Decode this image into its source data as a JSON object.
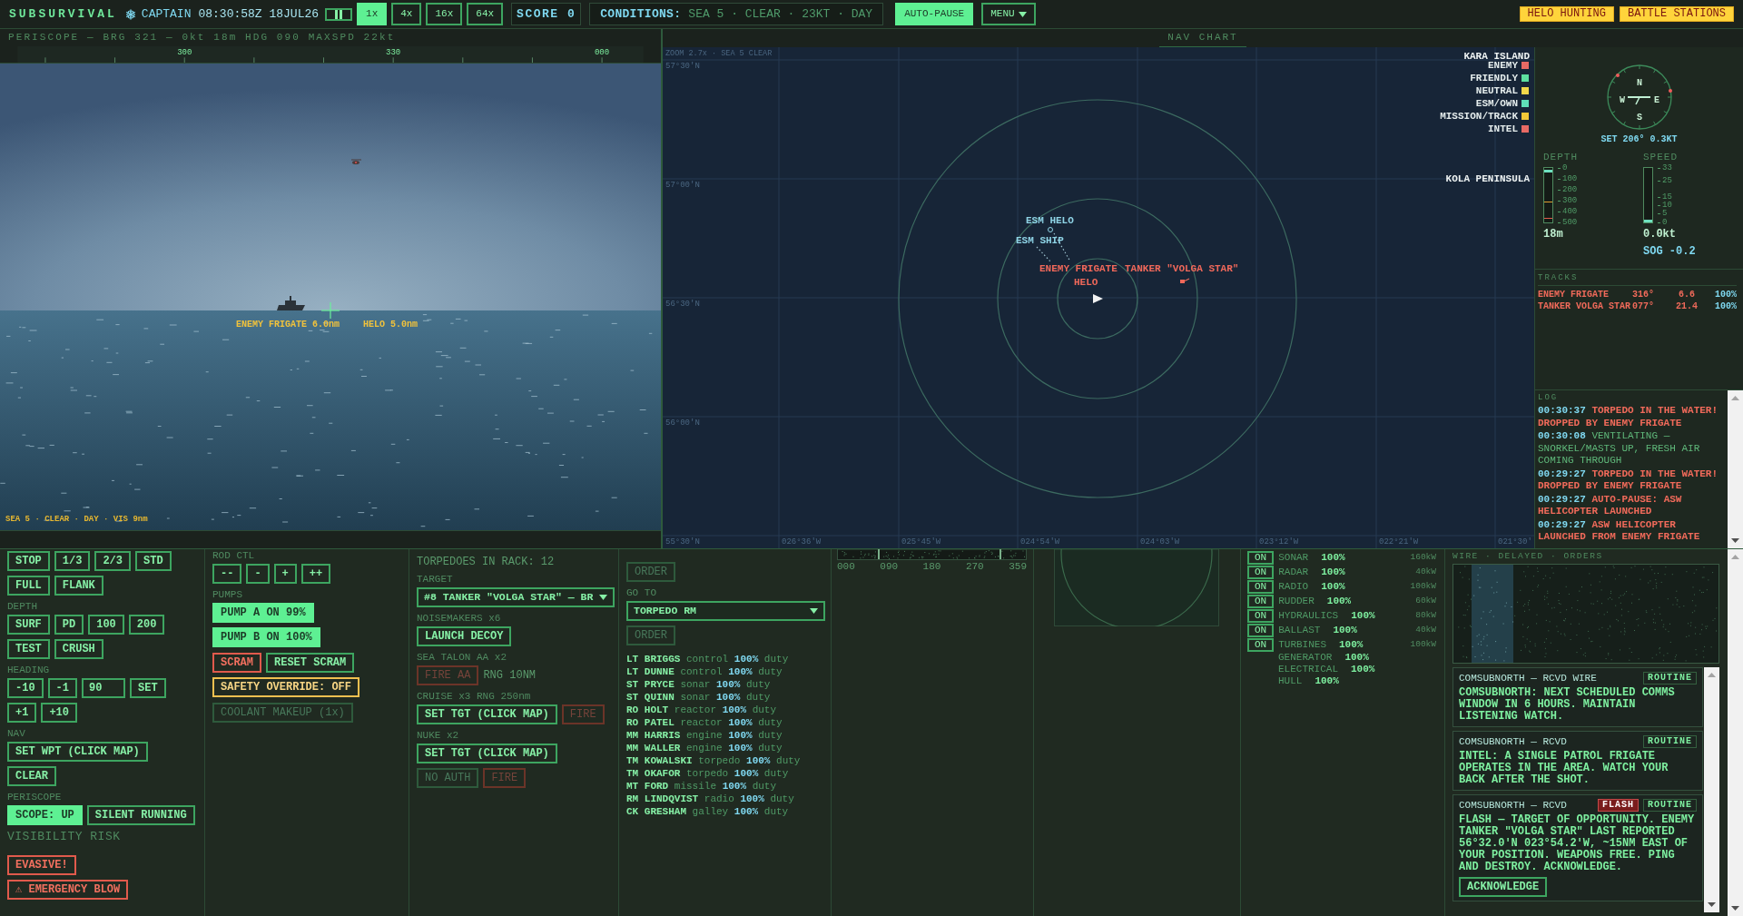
{
  "top_bar": {
    "title": "SUBSURVIVAL",
    "role": "CAPTAIN",
    "clock": "08:30:58Z 18JUL26",
    "time_scales": [
      {
        "label": "1x",
        "selected": true
      },
      {
        "label": "4x",
        "selected": false
      },
      {
        "label": "16x",
        "selected": false
      },
      {
        "label": "64x",
        "selected": false
      }
    ],
    "score": "SCORE 0",
    "conditions": {
      "label": "CONDITIONS:",
      "value": "SEA 5 · CLEAR · 23KT · DAY"
    },
    "auto_pause": {
      "label": "AUTO-PAUSE",
      "on": true
    },
    "menu": "MENU",
    "alerts": [
      "HELO HUNTING",
      "BATTLE STATIONS"
    ]
  },
  "periscope": {
    "header": "PERISCOPE — BRG 321 — 0kt 18m HDG 090 MAXSPD 22kt",
    "bearings": [
      "300",
      "330",
      "000"
    ],
    "contacts": [
      {
        "kind": "ship",
        "label": "ENEMY FRIGATE 6.0nm"
      },
      {
        "kind": "helo",
        "label": "HELO 5.0nm"
      }
    ],
    "footer": "SEA 5 · CLEAR · DAY · VIS 9nm"
  },
  "nav_chart": {
    "title": "NAV CHART",
    "zoom_note": "ZOOM 2.7x · SEA 5 CLEAR",
    "latitudes": [
      "57°30'N",
      "57°00'N",
      "56°30'N",
      "56°00'N",
      "55°30'N"
    ],
    "longitudes": [
      "026°36'W",
      "025°45'W",
      "024°54'W",
      "024°03'W",
      "023°12'W",
      "022°21'W",
      "021°30'"
    ],
    "places": [
      "KARA ISLAND",
      "KOLA PENINSULA"
    ],
    "legend": [
      {
        "label": "ENEMY",
        "color": "#e86a64"
      },
      {
        "label": "FRIENDLY",
        "color": "#5ee0a0"
      },
      {
        "label": "NEUTRAL",
        "color": "#f2d84a"
      },
      {
        "label": "ESM/OWN",
        "color": "#5ee0b8"
      },
      {
        "label": "MISSION/TRACK",
        "color": "#f2c838"
      },
      {
        "label": "INTEL",
        "color": "#e86a64"
      }
    ],
    "contacts": [
      {
        "kind": "esm",
        "label": "ESM HELO"
      },
      {
        "kind": "esm",
        "label": "ESM SHIP"
      },
      {
        "kind": "enemy",
        "label": "ENEMY FRIGATE"
      },
      {
        "kind": "enemy",
        "label": "HELO"
      },
      {
        "kind": "enemy",
        "label": "TANKER \"VOLGA STAR\""
      }
    ]
  },
  "right_panel": {
    "compass": {
      "letters": [
        "N",
        "E",
        "S",
        "W"
      ],
      "set": "SET 206° 0.3KT"
    },
    "depth": {
      "label": "DEPTH",
      "ticks": [
        "0",
        "100",
        "200",
        "300",
        "400",
        "500"
      ],
      "reading": "18m",
      "level": 0.036
    },
    "speed": {
      "label": "SPEED",
      "ticks": [
        "33",
        "25",
        "15",
        "10",
        "5",
        "0"
      ],
      "reading": "0.0kt",
      "level": 0,
      "sog": "SOG -0.2"
    },
    "tracks": {
      "title": "TRACKS",
      "rows": [
        {
          "name": "ENEMY FRIGATE",
          "bearing": "316°",
          "range": "6.6",
          "quality": "100%"
        },
        {
          "name": "TANKER VOLGA STAR",
          "bearing": "077°",
          "range": "21.4",
          "quality": "100%"
        }
      ]
    },
    "log": {
      "title": "LOG",
      "entries": [
        {
          "time": "00:30:37",
          "text": "TORPEDO IN THE WATER! DROPPED BY ENEMY FRIGATE",
          "kind": "alert"
        },
        {
          "time": "00:30:08",
          "text": "VENTILATING — SNORKEL/MASTS UP, FRESH AIR COMING THROUGH",
          "kind": "info"
        },
        {
          "time": "00:29:27",
          "text": "TORPEDO IN THE WATER! DROPPED BY ENEMY FRIGATE",
          "kind": "alert"
        },
        {
          "time": "00:29:27",
          "text": "AUTO-PAUSE: ASW HELICOPTER LAUNCHED",
          "kind": "alert"
        },
        {
          "time": "00:29:27",
          "text": "ASW HELICOPTER LAUNCHED FROM ENEMY FRIGATE",
          "kind": "alert"
        }
      ]
    }
  },
  "helm": {
    "sections": [
      {
        "rows": [
          [
            {
              "kind": "button",
              "label": "STOP"
            },
            {
              "kind": "button",
              "label": "1/3"
            },
            {
              "kind": "button",
              "label": "2/3"
            },
            {
              "kind": "button",
              "label": "STD"
            }
          ],
          [
            {
              "kind": "button",
              "label": "FULL"
            },
            {
              "kind": "button",
              "label": "FLANK"
            }
          ]
        ]
      },
      {
        "label": "DEPTH",
        "rows": [
          [
            {
              "kind": "button",
              "label": "SURF"
            },
            {
              "kind": "button",
              "label": "PD"
            },
            {
              "kind": "button",
              "label": "100"
            },
            {
              "kind": "button",
              "label": "200"
            }
          ],
          [
            {
              "kind": "button",
              "label": "TEST"
            },
            {
              "kind": "button",
              "label": "CRUSH"
            }
          ]
        ]
      },
      {
        "label": "HEADING",
        "rows": [
          [
            {
              "kind": "button",
              "label": "-10"
            },
            {
              "kind": "button",
              "label": "-1"
            },
            {
              "kind": "field",
              "value": "90"
            },
            {
              "kind": "button",
              "label": "SET"
            }
          ],
          [
            {
              "kind": "button",
              "label": "+1"
            },
            {
              "kind": "button",
              "label": "+10"
            }
          ]
        ]
      },
      {
        "label": "NAV",
        "rows": [
          [
            {
              "kind": "button",
              "label": "SET WPT (CLICK MAP)"
            }
          ],
          [
            {
              "kind": "button",
              "label": "CLEAR"
            }
          ]
        ]
      },
      {
        "label": "PERISCOPE",
        "rows": [
          [
            {
              "kind": "button",
              "label": "SCOPE: UP",
              "on": true
            },
            {
              "kind": "button",
              "label": "SILENT RUNNING",
              "on": false
            }
          ]
        ]
      },
      {
        "label": "VISIBILITY RISK"
      },
      {
        "rows": [
          [
            {
              "kind": "alarm",
              "label": "EVASIVE!"
            }
          ],
          [
            {
              "kind": "alarm",
              "label": "⚠ EMERGENCY BLOW"
            }
          ]
        ]
      }
    ]
  },
  "reactor": {
    "sections": [
      {
        "label": "ROD CTL",
        "rows": [
          [
            {
              "kind": "button",
              "label": "--"
            },
            {
              "kind": "button",
              "label": "-"
            },
            {
              "kind": "button",
              "label": "+"
            },
            {
              "kind": "button",
              "label": "++"
            }
          ]
        ]
      },
      {
        "label": "PUMPS",
        "rows": [
          [
            {
              "kind": "button",
              "label": "PUMP A ON 99%",
              "on": true
            }
          ],
          [
            {
              "kind": "button",
              "label": "PUMP B ON 100%",
              "on": true
            }
          ]
        ]
      },
      {
        "rows": [
          [
            {
              "kind": "alarm",
              "label": "SCRAM"
            },
            {
              "kind": "button",
              "label": "RESET SCRAM"
            }
          ],
          [
            {
              "kind": "caution",
              "label": "SAFETY OVERRIDE: OFF"
            }
          ]
        ]
      },
      {
        "rows": [
          [
            {
              "kind": "button",
              "label": "COOLANT MAKEUP (1x)",
              "disabled": true
            }
          ]
        ]
      }
    ]
  },
  "weapons": {
    "sections": [
      {
        "rows": [
          [
            {
              "kind": "text",
              "label": "TORPEDOES IN RACK: 12"
            }
          ]
        ]
      },
      {
        "label": "TARGET",
        "rows": [
          [
            {
              "kind": "select",
              "value": "#8 TANKER \"VOLGA STAR\" — BR"
            }
          ]
        ]
      },
      {
        "label": "NOISEMAKERS x6",
        "rows": [
          [
            {
              "kind": "button",
              "label": "LAUNCH DECOY"
            }
          ]
        ]
      },
      {
        "label": "SEA TALON AA x2",
        "rows": [
          [
            {
              "kind": "alarm",
              "label": "FIRE AA",
              "disabled": true
            },
            {
              "kind": "text",
              "label": "RNG 10NM"
            }
          ]
        ]
      },
      {
        "label": "CRUISE x3 RNG 250nm",
        "rows": [
          [
            {
              "kind": "button",
              "label": "SET TGT (CLICK MAP)"
            },
            {
              "kind": "alarm",
              "label": "FIRE",
              "disabled": true
            }
          ]
        ]
      },
      {
        "label": "NUKE x2",
        "rows": [
          [
            {
              "kind": "button",
              "label": "SET TGT (CLICK MAP)"
            }
          ],
          [
            {
              "kind": "button",
              "label": "NO AUTH",
              "disabled": true
            },
            {
              "kind": "alarm",
              "label": "FIRE",
              "disabled": true
            }
          ]
        ]
      }
    ]
  },
  "crew_orders": {
    "sections": [
      {
        "rows": [
          [
            {
              "kind": "button",
              "label": "ORDER",
              "disabled": true
            }
          ]
        ]
      },
      {
        "label": "GO TO",
        "rows": [
          [
            {
              "kind": "select",
              "value": "TORPEDO RM"
            }
          ],
          [
            {
              "kind": "button",
              "label": "ORDER",
              "disabled": true
            }
          ]
        ]
      }
    ],
    "crew": [
      {
        "name": "LT BRIGGS",
        "station": "control",
        "readiness": "100%",
        "status": "duty"
      },
      {
        "name": "LT DUNNE",
        "station": "control",
        "readiness": "100%",
        "status": "duty"
      },
      {
        "name": "ST PRYCE",
        "station": "sonar",
        "readiness": "100%",
        "status": "duty"
      },
      {
        "name": "ST QUINN",
        "station": "sonar",
        "readiness": "100%",
        "status": "duty"
      },
      {
        "name": "RO HOLT",
        "station": "reactor",
        "readiness": "100%",
        "status": "duty"
      },
      {
        "name": "RO PATEL",
        "station": "reactor",
        "readiness": "100%",
        "status": "duty"
      },
      {
        "name": "MM HARRIS",
        "station": "engine",
        "readiness": "100%",
        "status": "duty"
      },
      {
        "name": "MM WALLER",
        "station": "engine",
        "readiness": "100%",
        "status": "duty"
      },
      {
        "name": "TM KOWALSKI",
        "station": "torpedo",
        "readiness": "100%",
        "status": "duty"
      },
      {
        "name": "TM OKAFOR",
        "station": "torpedo",
        "readiness": "100%",
        "status": "duty"
      },
      {
        "name": "MT FORD",
        "station": "missile",
        "readiness": "100%",
        "status": "duty"
      },
      {
        "name": "RM LINDQVIST",
        "station": "radio",
        "readiness": "100%",
        "status": "duty"
      },
      {
        "name": "CK GRESHAM",
        "station": "galley",
        "readiness": "100%",
        "status": "duty"
      }
    ]
  },
  "sonar": {
    "bearings": [
      "000",
      "090",
      "180",
      "270",
      "359"
    ]
  },
  "power": {
    "systems": [
      {
        "switch": {
          "label": "ON",
          "on": true
        },
        "name": "SONAR",
        "health": "100%",
        "load": "160kW"
      },
      {
        "switch": {
          "label": "ON",
          "on": true
        },
        "name": "RADAR",
        "health": "100%",
        "load": "40kW"
      },
      {
        "switch": {
          "label": "ON",
          "on": true
        },
        "name": "RADIO",
        "health": "100%",
        "load": "100kW"
      },
      {
        "switch": {
          "label": "ON",
          "on": true
        },
        "name": "RUDDER",
        "health": "100%",
        "load": "60kW"
      },
      {
        "switch": {
          "label": "ON",
          "on": true
        },
        "name": "HYDRAULICS",
        "health": "100%",
        "load": "80kW"
      },
      {
        "switch": {
          "label": "ON",
          "on": true
        },
        "name": "BALLAST",
        "health": "100%",
        "load": "40kW"
      },
      {
        "switch": {
          "label": "ON",
          "on": true
        },
        "name": "TURBINES",
        "health": "100%",
        "load": "100kW"
      },
      {
        "name": "GENERATOR",
        "health": "100%"
      },
      {
        "name": "ELECTRICAL",
        "health": "100%"
      },
      {
        "name": "HULL",
        "health": "100%"
      }
    ]
  },
  "comms": {
    "label": "WIRE · DELAYED · ORDERS",
    "messages": [
      {
        "header": "COMSUBNORTH — RCVD WIRE",
        "tags": [
          {
            "kind": "routine",
            "label": "ROUTINE"
          }
        ],
        "body": "COMSUBNORTH: NEXT SCHEDULED COMMS WINDOW IN 6 HOURS. MAINTAIN LISTENING WATCH."
      },
      {
        "header": "COMSUBNORTH — RCVD",
        "tags": [
          {
            "kind": "routine",
            "label": "ROUTINE"
          }
        ],
        "body": "INTEL: A SINGLE PATROL FRIGATE OPERATES IN THE AREA. WATCH YOUR BACK AFTER THE SHOT."
      },
      {
        "header": "COMSUBNORTH — RCVD",
        "tags": [
          {
            "kind": "flash",
            "label": "FLASH"
          },
          {
            "kind": "routine",
            "label": "ROUTINE"
          }
        ],
        "body": "FLASH — TARGET OF OPPORTUNITY. ENEMY TANKER \"VOLGA STAR\" LAST REPORTED 56°32.0'N 023°54.2'W, ~15NM EAST OF YOUR POSITION. WEAPONS FREE. PING AND DESTROY. ACKNOWLEDGE.",
        "action": "ACKNOWLEDGE"
      }
    ]
  }
}
